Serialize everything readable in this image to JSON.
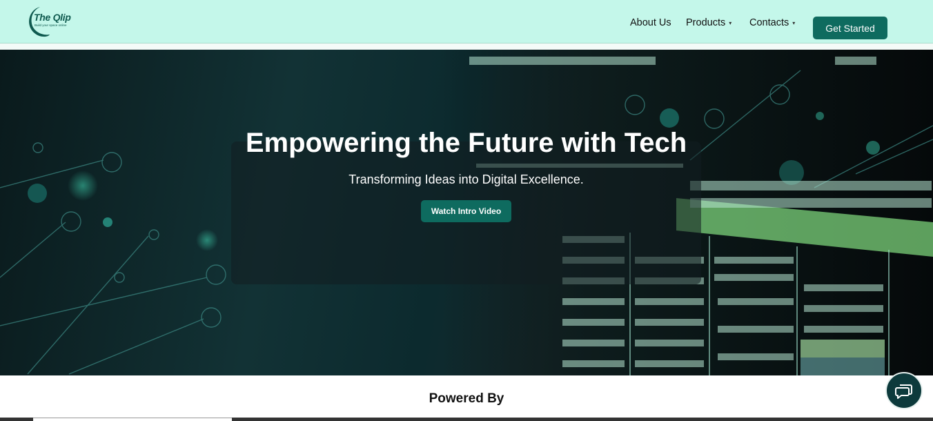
{
  "header": {
    "logo_title": "The Qlip",
    "logo_tagline": "Build your space online",
    "nav": [
      {
        "label": "About Us",
        "has_dropdown": false
      },
      {
        "label": "Products",
        "has_dropdown": true
      },
      {
        "label": "Contacts",
        "has_dropdown": true
      }
    ],
    "cta_label": "Get Started"
  },
  "hero": {
    "title": "Empowering the Future with Tech",
    "subtitle": "Transforming Ideas into Digital Excellence.",
    "button_label": "Watch Intro Video"
  },
  "powered_by": {
    "heading": "Powered By"
  },
  "icons": {
    "dropdown": "caret-down-icon",
    "chat": "chat-bubble-icon"
  },
  "colors": {
    "header_bg": "#c4f7ea",
    "brand": "#0e6b5f",
    "chat_bg": "#0d3a3c"
  }
}
